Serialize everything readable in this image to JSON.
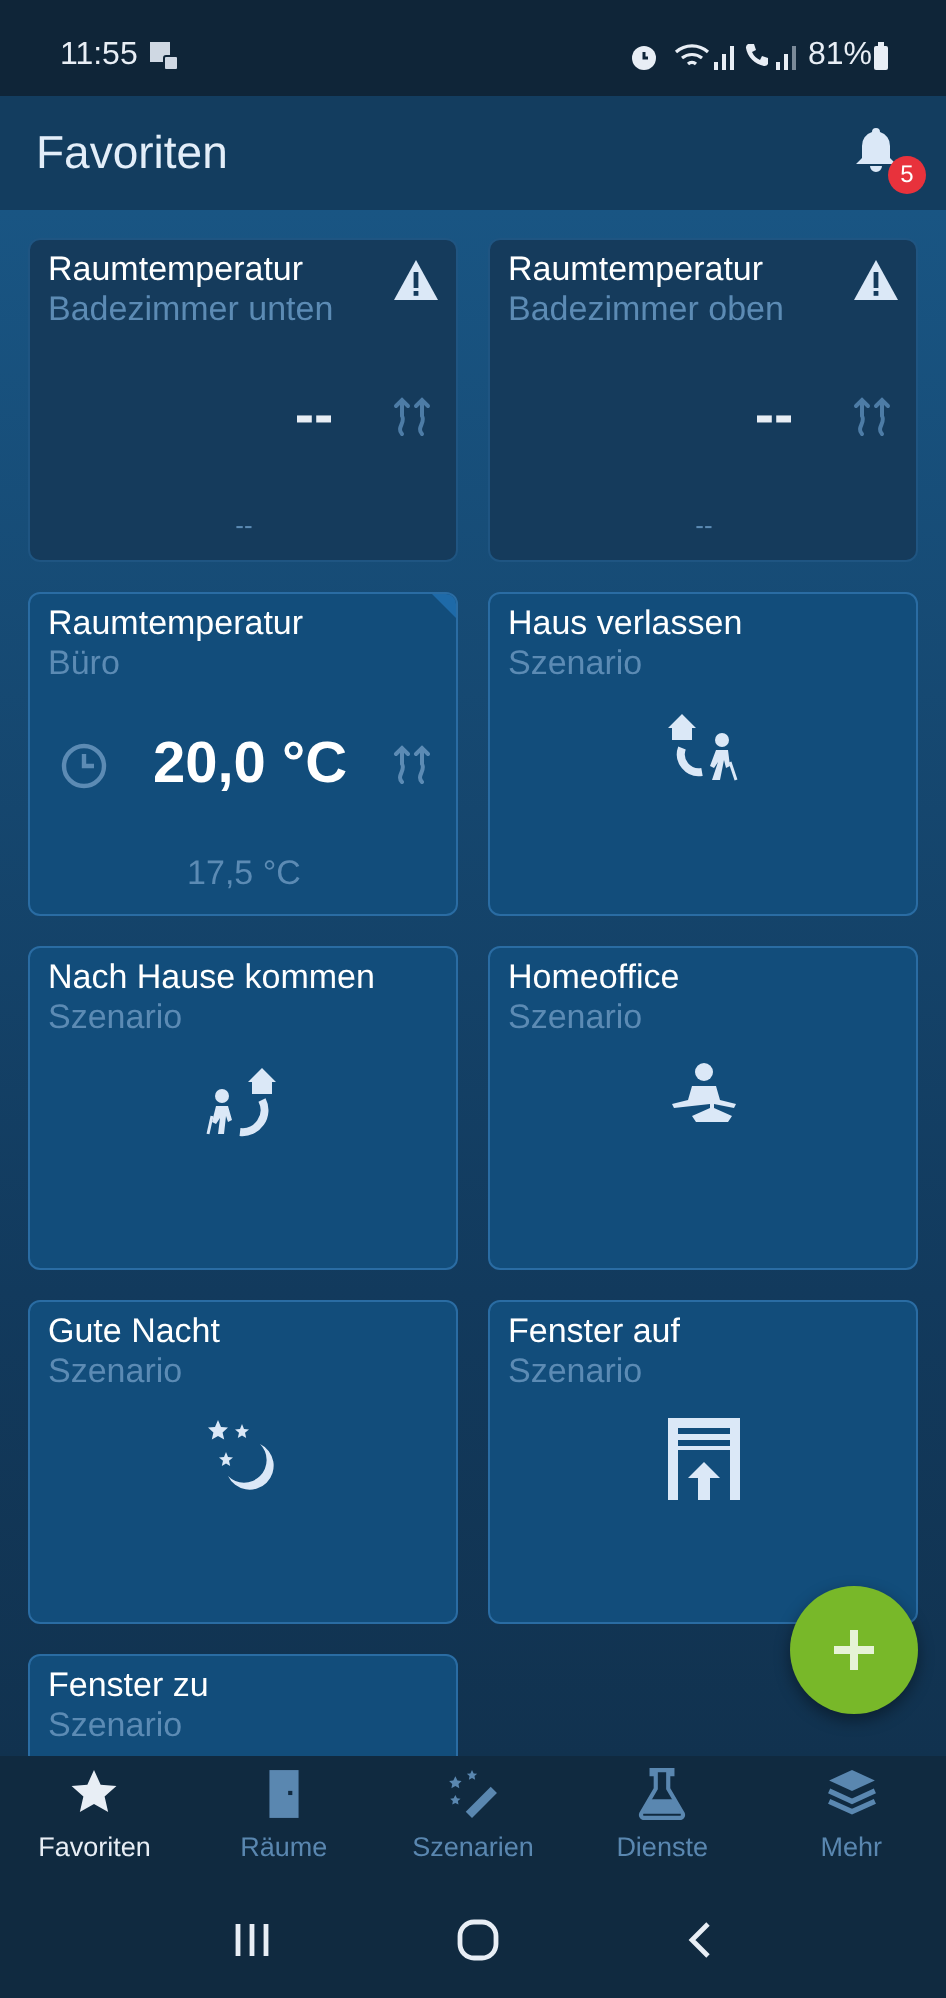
{
  "status_bar": {
    "time": "11:55",
    "battery": "81%"
  },
  "header": {
    "title": "Favoriten",
    "notification_count": "5"
  },
  "tiles": [
    {
      "kind": "thermostat",
      "title": "Raumtemperatur",
      "subtitle": "Badezimmer unten",
      "value": "--",
      "setpoint": "--",
      "warning": true,
      "schedule": false,
      "available": false
    },
    {
      "kind": "thermostat",
      "title": "Raumtemperatur",
      "subtitle": "Badezimmer oben",
      "value": "--",
      "setpoint": "--",
      "warning": true,
      "schedule": false,
      "available": false
    },
    {
      "kind": "thermostat",
      "title": "Raumtemperatur",
      "subtitle": "Büro",
      "value": "20,0 °C",
      "setpoint": "17,5 °C",
      "warning": false,
      "schedule": true,
      "available": true
    },
    {
      "kind": "scenario",
      "title": "Haus verlassen",
      "subtitle": "Szenario"
    },
    {
      "kind": "scenario",
      "title": "Nach Hause kommen",
      "subtitle": "Szenario"
    },
    {
      "kind": "scenario",
      "title": "Homeoffice",
      "subtitle": "Szenario"
    },
    {
      "kind": "scenario",
      "title": "Gute Nacht",
      "subtitle": "Szenario"
    },
    {
      "kind": "scenario",
      "title": "Fenster auf",
      "subtitle": "Szenario"
    },
    {
      "kind": "scenario",
      "title": "Fenster zu",
      "subtitle": "Szenario"
    }
  ],
  "bottom_nav": [
    {
      "label": "Favoriten",
      "selected": true
    },
    {
      "label": "Räume",
      "selected": false
    },
    {
      "label": "Szenarien",
      "selected": false
    },
    {
      "label": "Dienste",
      "selected": false
    },
    {
      "label": "Mehr",
      "selected": false
    }
  ]
}
